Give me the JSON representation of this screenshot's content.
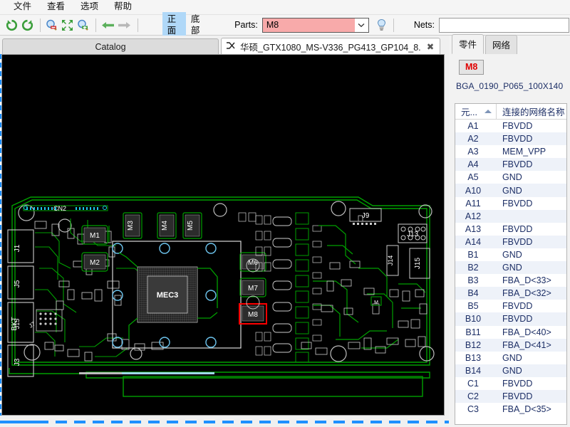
{
  "menu": {
    "items": [
      {
        "label": "文件",
        "name": "menu-file"
      },
      {
        "label": "查看",
        "name": "menu-view"
      },
      {
        "label": "选项",
        "name": "menu-options"
      },
      {
        "label": "帮助",
        "name": "menu-help"
      }
    ]
  },
  "toolbar": {
    "icons": [
      {
        "name": "rotate-left-icon"
      },
      {
        "name": "rotate-right-icon"
      },
      {
        "name": "zoom-out-icon"
      },
      {
        "name": "fit-to-screen-icon"
      },
      {
        "name": "zoom-in-icon"
      },
      {
        "name": "back-arrow-icon"
      },
      {
        "name": "forward-arrow-icon"
      }
    ],
    "view_front_label": "正面",
    "view_bottom_label": "底部",
    "parts_label": "Parts:",
    "parts_value": "M8",
    "parts_field_color": "#f8aaaa",
    "highlight_icon": "lightbulb-icon",
    "nets_label": "Nets:",
    "nets_value": "",
    "nets_placeholder": ""
  },
  "tabs": {
    "catalog_label": "Catalog",
    "document_label": "华硕_GTX1080_MS-V336_PG413_GP104_8...",
    "document_icon": "shuffle-icon",
    "close_label": "✖"
  },
  "board": {
    "background": "#000000",
    "trace_color": "#00a000",
    "silk_color": "#d8d8d8",
    "selection_color": "#ff0000",
    "pad_highlight_color": "#6ec6f0",
    "selected_part": "M8",
    "bga_label": "MEC3",
    "labels": [
      "CN2",
      "J1",
      "BKT",
      "J5",
      "J3",
      "J4",
      "M1",
      "M2",
      "M3",
      "M4",
      "M5",
      "M6",
      "M7",
      "M8",
      "J9",
      "J13",
      "J15",
      "J14"
    ]
  },
  "right_panel": {
    "tabs": [
      {
        "label": "零件",
        "name": "tab-parts",
        "active": true
      },
      {
        "label": "网络",
        "name": "tab-nets",
        "active": false
      }
    ],
    "part_badge": "M8",
    "part_badge_color": "#e00000",
    "package_name": "BGA_0190_P065_100X140",
    "table": {
      "headers": [
        "元...",
        "连接的网络名称"
      ],
      "sort_column": 0,
      "sort_direction": "asc",
      "rows": [
        [
          "A1",
          "FBVDD"
        ],
        [
          "A2",
          "FBVDD"
        ],
        [
          "A3",
          "MEM_VPP"
        ],
        [
          "A4",
          "FBVDD"
        ],
        [
          "A5",
          "GND"
        ],
        [
          "A10",
          "GND"
        ],
        [
          "A11",
          "FBVDD"
        ],
        [
          "A12",
          ""
        ],
        [
          "A13",
          "FBVDD"
        ],
        [
          "A14",
          "FBVDD"
        ],
        [
          "B1",
          "GND"
        ],
        [
          "B2",
          "GND"
        ],
        [
          "B3",
          "FBA_D<33>"
        ],
        [
          "B4",
          "FBA_D<32>"
        ],
        [
          "B5",
          "FBVDD"
        ],
        [
          "B10",
          "FBVDD"
        ],
        [
          "B11",
          "FBA_D<40>"
        ],
        [
          "B12",
          "FBA_D<41>"
        ],
        [
          "B13",
          "GND"
        ],
        [
          "B14",
          "GND"
        ],
        [
          "C1",
          "FBVDD"
        ],
        [
          "C2",
          "FBVDD"
        ],
        [
          "C3",
          "FBA_D<35>"
        ]
      ]
    }
  }
}
